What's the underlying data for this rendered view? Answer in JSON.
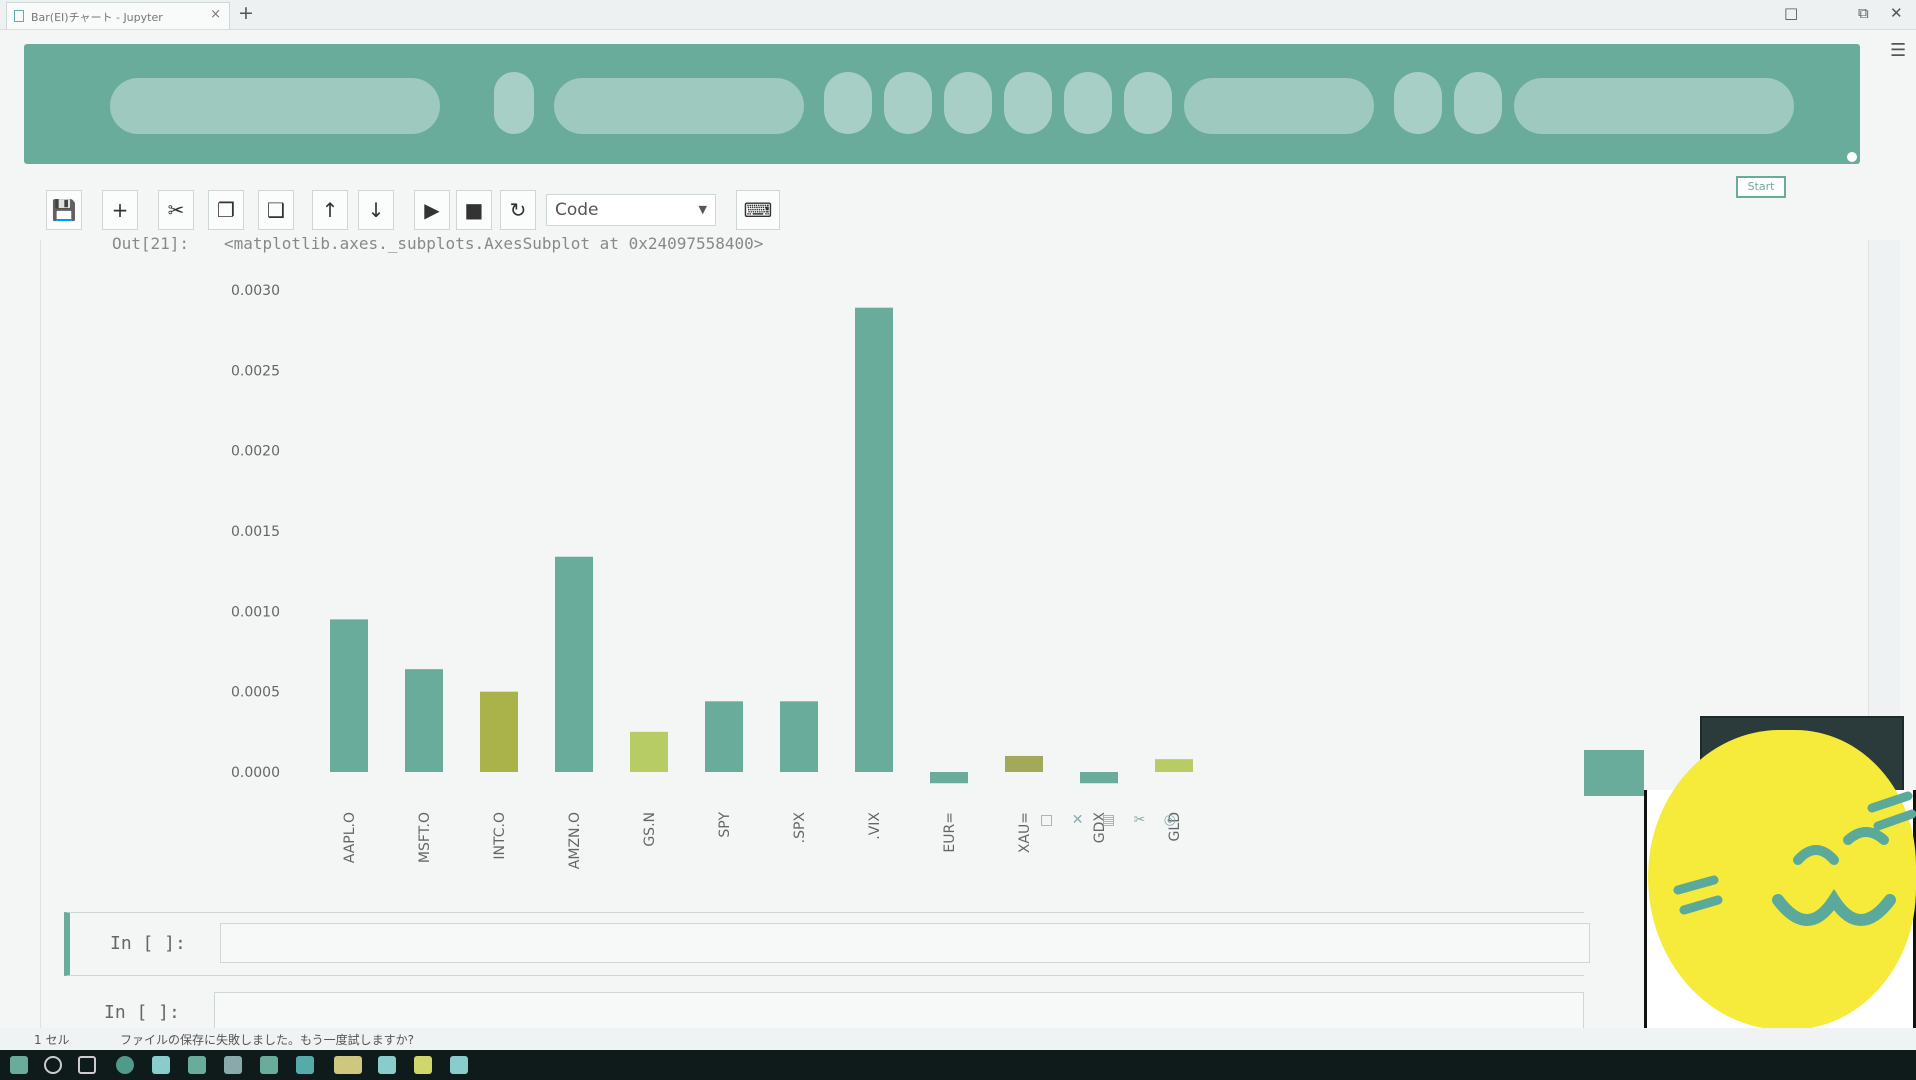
{
  "browser": {
    "tab_title": "Bar(EI)チャート - Jupyter",
    "new_tab": "+",
    "close_tab": "×"
  },
  "toolbar": {
    "cell_type": "Code",
    "start_label": "Start"
  },
  "output": {
    "prompt": "Out[21]:",
    "text": "<matplotlib.axes._subplots.AxesSubplot at 0x24097558400>"
  },
  "cells": [
    {
      "prompt": "In  [  ]:"
    },
    {
      "prompt": "In  [  ]:"
    }
  ],
  "statusbar": {
    "left": "1 セル",
    "message": "ファイルの保存に失敗しました。もう一度試しますか?"
  },
  "chart_data": {
    "type": "bar",
    "categories": [
      "AAPL.O",
      "MSFT.O",
      "INTC.O",
      "AMZN.O",
      "GS.N",
      "SPY",
      ".SPX",
      ".VIX",
      "EUR=",
      "XAU=",
      "GDX",
      "GLD"
    ],
    "values": [
      0.00095,
      0.00064,
      0.0005,
      0.00134,
      0.00025,
      0.00044,
      0.00044,
      0.00289,
      -7e-05,
      0.0001,
      -7e-05,
      8e-05
    ],
    "colors": [
      "#6aac9c",
      "#6aac9c",
      "#aab24a",
      "#6aac9c",
      "#b8cc66",
      "#6aac9c",
      "#6aac9c",
      "#6aac9c",
      "#6aac9c",
      "#a3a95a",
      "#6aac9c",
      "#b8cc66"
    ],
    "yticks": [
      "0.0000",
      "0.0005",
      "0.0010",
      "0.0015",
      "0.0020",
      "0.0025",
      "0.0030"
    ],
    "ylim": [
      -0.0001,
      0.003
    ],
    "grid": false
  }
}
